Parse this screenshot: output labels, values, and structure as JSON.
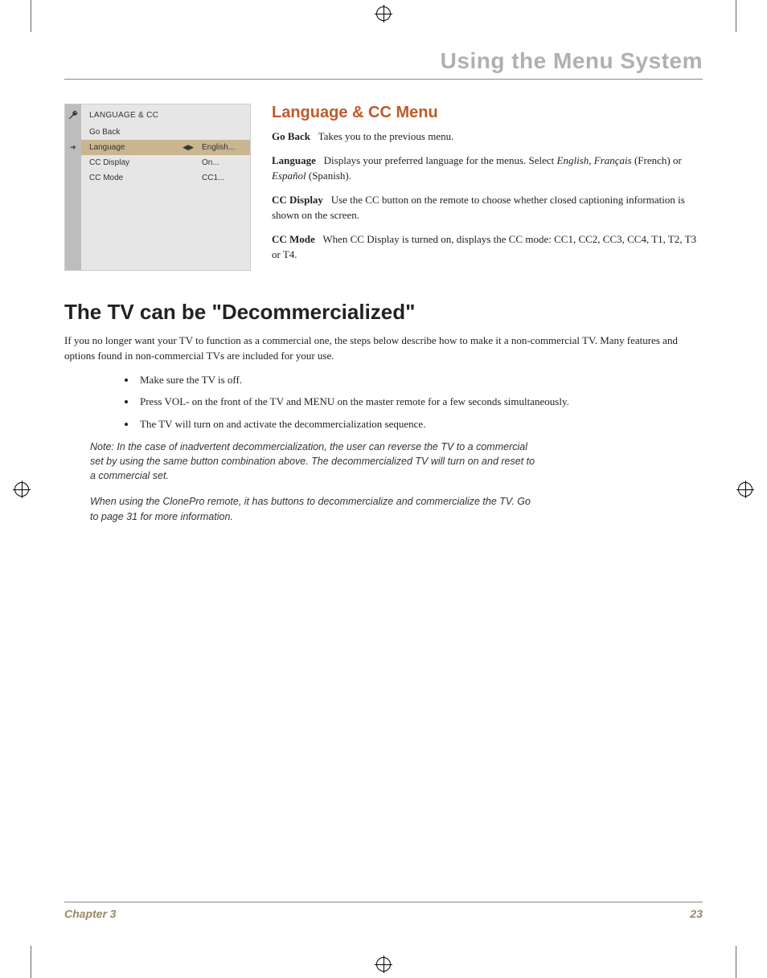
{
  "header": {
    "title": "Using the Menu System"
  },
  "menu": {
    "title": "LANGUAGE & CC",
    "rows": [
      {
        "label": "Go Back",
        "value": "",
        "selected": false
      },
      {
        "label": "Language",
        "value": "English...",
        "selected": true,
        "arrows": true
      },
      {
        "label": "CC Display",
        "value": "On...",
        "selected": false
      },
      {
        "label": "CC Mode",
        "value": "CC1...",
        "selected": false
      }
    ]
  },
  "section": {
    "title": "Language & CC Menu",
    "goback_label": "Go Back",
    "goback_text": "Takes you to the previous menu.",
    "language_label": "Language",
    "language_text_a": "Displays your preferred language for the menus. Select ",
    "language_em1": "English, Français",
    "language_text_b": " (French) or ",
    "language_em2": "Español",
    "language_text_c": " (Spanish).",
    "ccdisplay_label": "CC Display",
    "ccdisplay_text": "Use the CC button on the remote to choose whether closed captioning information is shown on the screen.",
    "ccmode_label": "CC Mode",
    "ccmode_text": "When CC Display is turned on, displays the CC mode: CC1, CC2, CC3, CC4, T1, T2, T3 or T4."
  },
  "decom": {
    "title": "The TV can be \"Decommercialized\"",
    "intro": "If you no longer want your TV to function as a commercial one, the steps below describe how to make it a non-commercial TV. Many features and options found in non-commercial TVs are included for your use.",
    "bullets": [
      "Make sure the TV is off.",
      "Press VOL- on the front of the TV and MENU on the master remote for a few seconds simultaneously.",
      "The TV will turn on and activate the decommercialization sequence."
    ],
    "note1": "Note: In the case of inadvertent decommercialization, the user can reverse the TV to a commercial set by using the same button combination above. The decommercialized TV will turn on and reset to a commercial set.",
    "note2": "When using the ClonePro remote, it has buttons to decommercialize and commercialize the TV. Go to page 31 for more information."
  },
  "footer": {
    "chapter": "Chapter 3",
    "page": "23"
  }
}
